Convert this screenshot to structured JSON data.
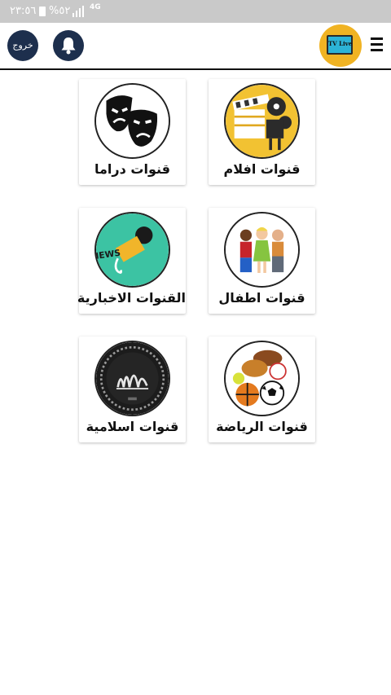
{
  "status_bar": {
    "time": "٢٣:٥٦",
    "battery": "%٥٢",
    "network": "4G"
  },
  "header": {
    "logout_label": "خروج",
    "logo_text": "TV Live",
    "icons": {
      "notifications": "bell-icon",
      "menu": "hamburger-menu-icon"
    }
  },
  "categories": [
    {
      "label": "قنوات افلام",
      "icon": "film-projector-icon"
    },
    {
      "label": "قنوات دراما",
      "icon": "drama-masks-icon"
    },
    {
      "label": "قنوات اطفال",
      "icon": "kids-icon"
    },
    {
      "label": "القنوات الاخبارية",
      "icon": "news-microphone-icon"
    },
    {
      "label": "قنوات الرياضة",
      "icon": "sports-balls-icon"
    },
    {
      "label": "قنوات اسلامية",
      "icon": "islamic-calligraphy-icon"
    }
  ],
  "colors": {
    "header_button": "#1d2f4d",
    "logo_bg": "#f0b323",
    "status_bar": "#c9c9c9"
  }
}
